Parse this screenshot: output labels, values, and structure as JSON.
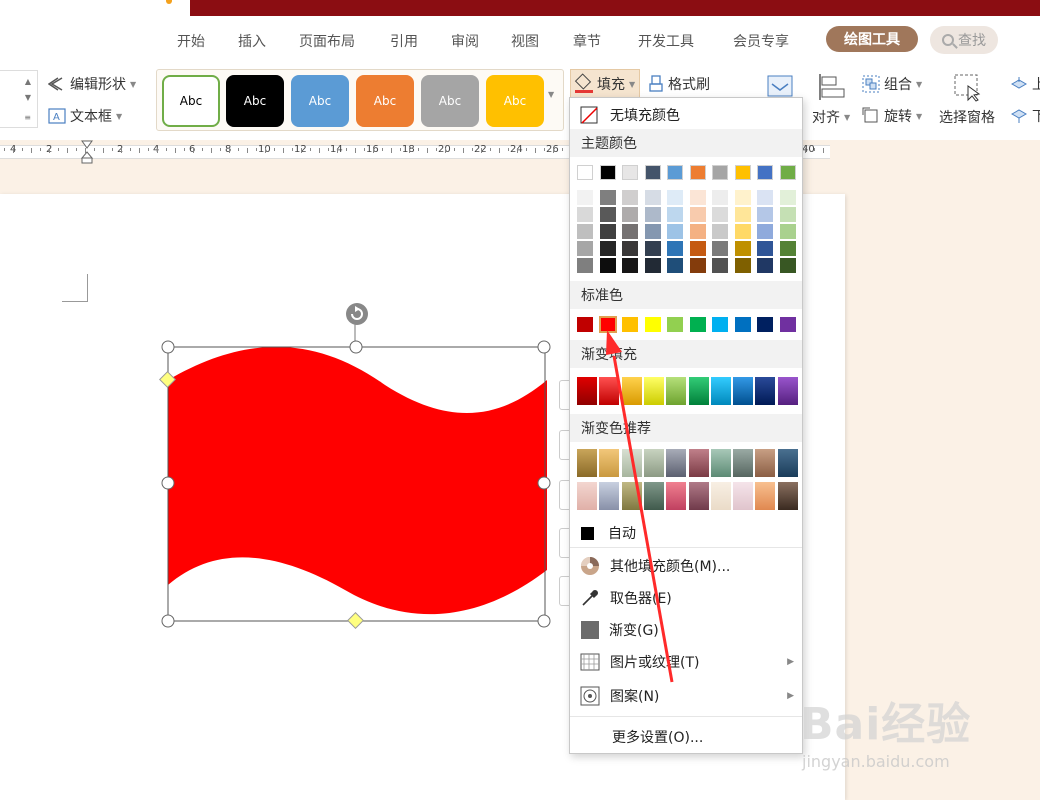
{
  "ribbon_tabs": [
    "开始",
    "插入",
    "页面布局",
    "引用",
    "审阅",
    "视图",
    "章节",
    "开发工具",
    "会员专享"
  ],
  "active_tab": "绘图工具",
  "search_label": "查找",
  "ribbon": {
    "edit_shape": "编辑形状",
    "text_box": "文本框",
    "style_swatches": [
      {
        "label": "Abc",
        "bg": "#ffffff",
        "fg": "#000000",
        "border": "#70ad47"
      },
      {
        "label": "Abc",
        "bg": "#000000",
        "fg": "#ffffff",
        "border": "#000000"
      },
      {
        "label": "Abc",
        "bg": "#5b9bd5",
        "fg": "#ffffff",
        "border": "#5b9bd5"
      },
      {
        "label": "Abc",
        "bg": "#ed7d31",
        "fg": "#ffffff",
        "border": "#ed7d31"
      },
      {
        "label": "Abc",
        "bg": "#a5a5a5",
        "fg": "#ffffff",
        "border": "#a5a5a5"
      },
      {
        "label": "Abc",
        "bg": "#ffc000",
        "fg": "#ffffff",
        "border": "#ffc000"
      }
    ],
    "fill": "填充",
    "format_painter": "格式刷",
    "align": "对齐",
    "group": "组合",
    "rotate": "旋转",
    "selection_pane": "选择窗格",
    "bring_forward": "上",
    "send_backward": "下"
  },
  "ruler_numbers": [
    "4",
    "2",
    "2",
    "4",
    "6",
    "8",
    "10",
    "12",
    "14",
    "16",
    "18",
    "20",
    "22",
    "24",
    "26",
    "40"
  ],
  "fill_menu": {
    "no_fill": "无填充颜色",
    "theme_colors": "主题颜色",
    "standard_colors": "标准色",
    "gradient_fill": "渐变填充",
    "gradient_recommend": "渐变色推荐",
    "auto": "自动",
    "more_fill_colors": "其他填充颜色(M)...",
    "eyedropper": "取色器(E)",
    "gradient": "渐变(G)",
    "picture_texture": "图片或纹理(T)",
    "pattern": "图案(N)",
    "more_settings": "更多设置(O)...",
    "theme_top_row": [
      "#ffffff",
      "#000000",
      "#e7e6e6",
      "#44546a",
      "#5b9bd5",
      "#ed7d31",
      "#a5a5a5",
      "#ffc000",
      "#4472c4",
      "#70ad47"
    ],
    "theme_shades": [
      [
        "#f2f2f2",
        "#7f7f7f",
        "#d0cece",
        "#d6dce5",
        "#deebf7",
        "#fbe5d6",
        "#ededed",
        "#fff2cc",
        "#dae3f3",
        "#e2f0d9"
      ],
      [
        "#d9d9d9",
        "#595959",
        "#aeabab",
        "#adb9ca",
        "#bdd7ee",
        "#f8cbad",
        "#dbdbdb",
        "#ffe699",
        "#b4c7e7",
        "#c5e0b4"
      ],
      [
        "#bfbfbf",
        "#404040",
        "#757171",
        "#8497b0",
        "#9dc3e6",
        "#f4b183",
        "#c9c9c9",
        "#ffd966",
        "#8faadc",
        "#a9d18e"
      ],
      [
        "#a6a6a6",
        "#262626",
        "#3a3838",
        "#333f50",
        "#2e75b6",
        "#c55a11",
        "#7b7b7b",
        "#bf9000",
        "#2f5597",
        "#548235"
      ],
      [
        "#7f7f7f",
        "#0d0d0d",
        "#171616",
        "#222a35",
        "#1f4e79",
        "#843c0c",
        "#525252",
        "#7f6000",
        "#203864",
        "#385723"
      ]
    ],
    "standard": [
      "#c00000",
      "#ff0000",
      "#ffc000",
      "#ffff00",
      "#92d050",
      "#00b050",
      "#00b0f0",
      "#0070c0",
      "#002060",
      "#7030a0"
    ],
    "gradient_row": [
      [
        "#e00000",
        "#900000"
      ],
      [
        "#ff5050",
        "#c00000"
      ],
      [
        "#ffd24d",
        "#d99a00"
      ],
      [
        "#ffff66",
        "#cccc00"
      ],
      [
        "#b5e07a",
        "#6ea32f"
      ],
      [
        "#33cc77",
        "#00803a"
      ],
      [
        "#33ccff",
        "#0088bb"
      ],
      [
        "#3399e6",
        "#004f8f"
      ],
      [
        "#2a4a99",
        "#001a55"
      ],
      [
        "#9955cc",
        "#55207f"
      ]
    ],
    "recommend_row1": [
      [
        "#c9a55a",
        "#8a6a28"
      ],
      [
        "#f2c77a",
        "#c99940"
      ],
      [
        "#d8e0d2",
        "#a7b59e"
      ],
      [
        "#c8d3c0",
        "#8c9a84"
      ],
      [
        "#a8acb8",
        "#5c6070"
      ],
      [
        "#c0808a",
        "#7a3a44"
      ],
      [
        "#a8c8b8",
        "#5c8a74"
      ],
      [
        "#9aaaa4",
        "#566660"
      ],
      [
        "#c89f84",
        "#8a5e44"
      ],
      [
        "#4a7090",
        "#1a3c5a"
      ]
    ],
    "recommend_row2": [
      [
        "#f3d6d0",
        "#e0b0a8"
      ],
      [
        "#c8d0e0",
        "#8890a8"
      ],
      [
        "#c0b884",
        "#807840"
      ],
      [
        "#80988a",
        "#405a4c"
      ],
      [
        "#f08090",
        "#c04060"
      ],
      [
        "#b07a88",
        "#703a4a"
      ],
      [
        "#f8efe4",
        "#eadbc8"
      ],
      [
        "#f5e4ea",
        "#e0c4cc"
      ],
      [
        "#f8c090",
        "#e08850"
      ],
      [
        "#8a7060",
        "#3a2a20"
      ]
    ]
  },
  "shape_fill": "#ff0000",
  "watermark": {
    "brand": "Bai经验",
    "url": "jingyan.baidu.com"
  }
}
